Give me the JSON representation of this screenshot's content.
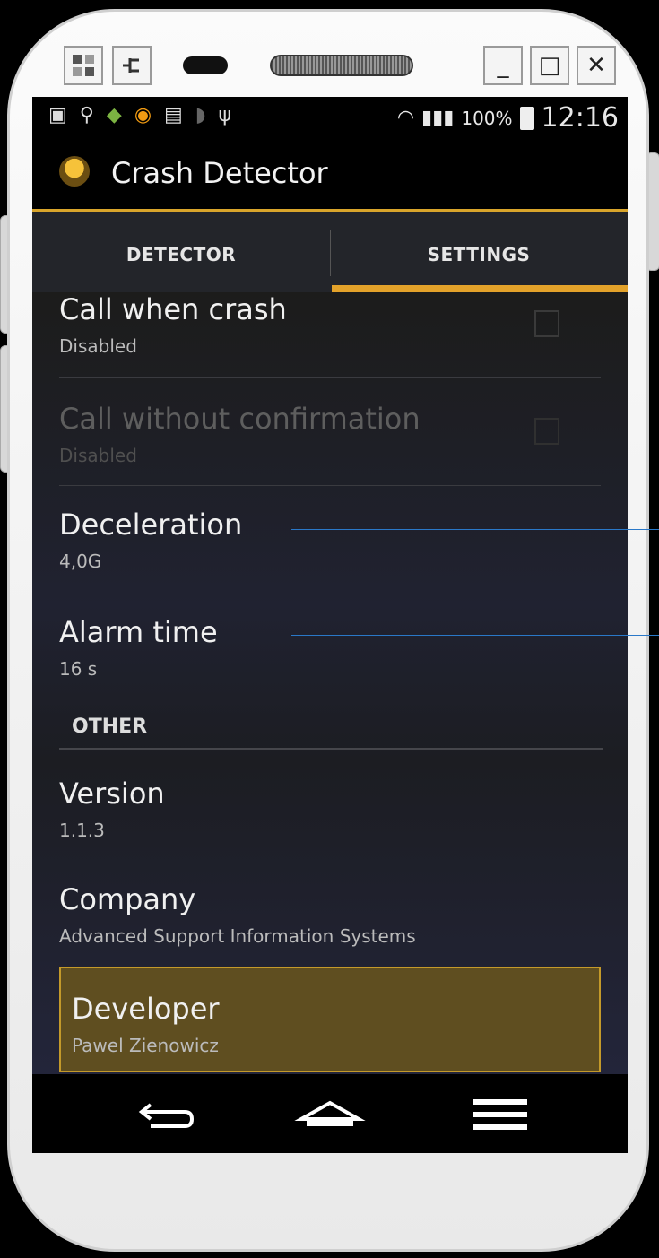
{
  "window_controls": {
    "minimize_label": "_",
    "maximize_label": "□",
    "close_label": "✕"
  },
  "status_bar": {
    "battery_percent": "100%",
    "time": "12:16"
  },
  "app": {
    "title": "Crash Detector"
  },
  "tabs": [
    {
      "label": "DETECTOR",
      "selected": false
    },
    {
      "label": "SETTINGS",
      "selected": true
    }
  ],
  "settings": {
    "call_when_crash": {
      "title": "Call when crash",
      "summary": "Disabled",
      "checked": false
    },
    "call_without_confirmation": {
      "title": "Call without confirmation",
      "summary": "Disabled",
      "checked": false,
      "enabled": false
    },
    "deceleration": {
      "title": "Deceleration",
      "summary": "4,0G"
    },
    "alarm_time": {
      "title": "Alarm time",
      "summary": "16 s"
    }
  },
  "other": {
    "header": "OTHER",
    "version": {
      "title": "Version",
      "summary": "1.1.3"
    },
    "company": {
      "title": "Company",
      "summary": "Advanced Support Information Systems"
    },
    "developer": {
      "title": "Developer",
      "summary": "Pawel Zienowicz"
    }
  },
  "colors": {
    "accent": "#e3a22a",
    "callout_line": "#2a78c8",
    "highlight": "#5f4e20"
  },
  "icons": [
    "grid-icon",
    "plug-icon",
    "minimize-icon",
    "maximize-icon",
    "close-icon",
    "back-icon",
    "home-icon",
    "menu-icon"
  ]
}
